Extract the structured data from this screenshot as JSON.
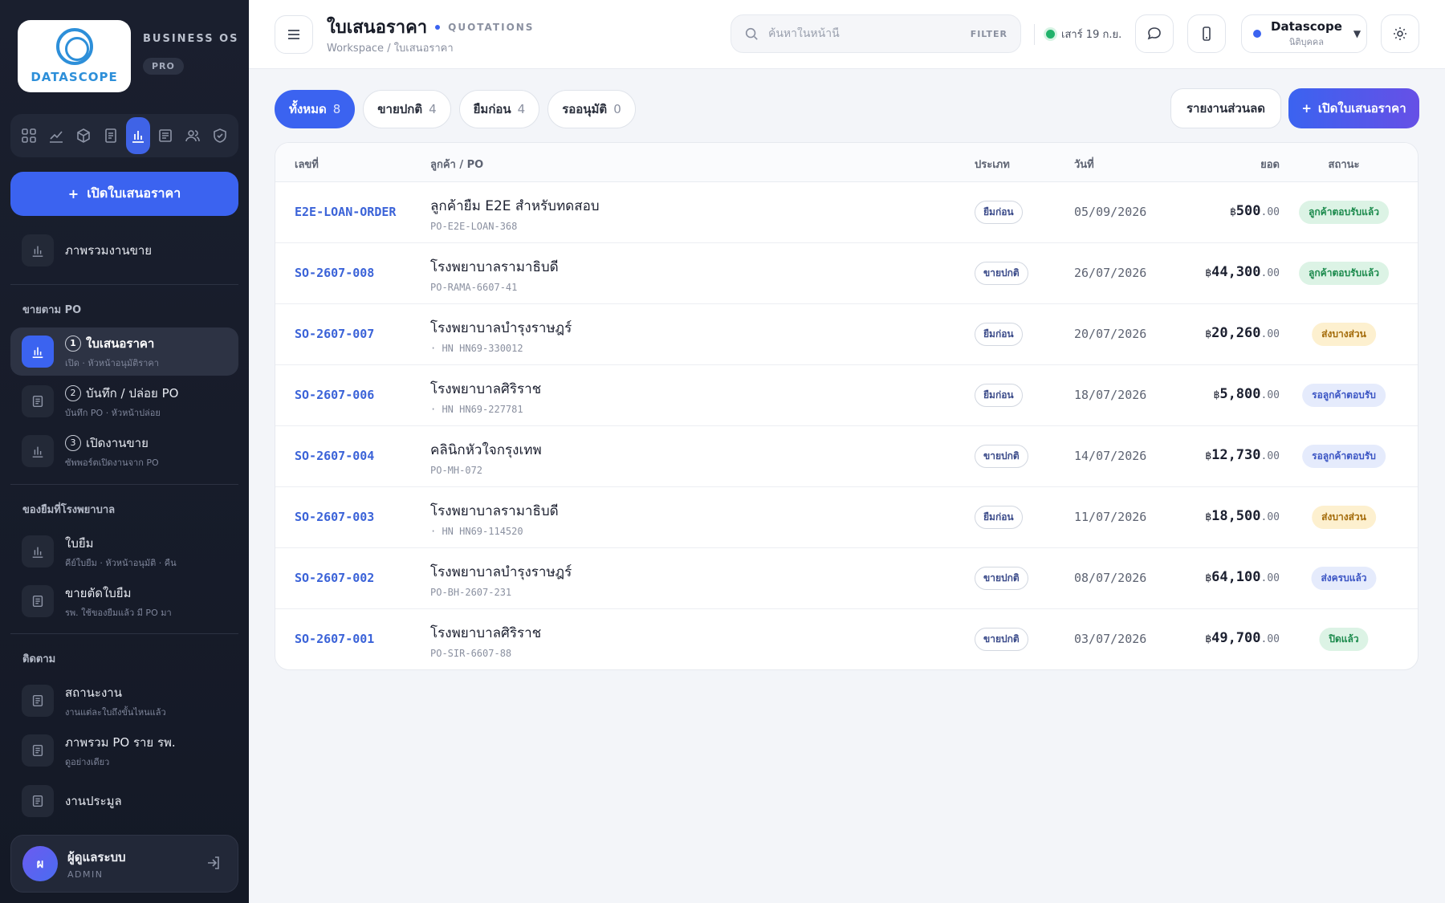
{
  "brand": {
    "logo_text": "DATASCOPE",
    "title": "BUSINESS OS",
    "badge": "PRO"
  },
  "sidebar": {
    "cta_label": "เปิดใบเสนอราคา",
    "overview_label": "ภาพรวมงานขาย",
    "section_po": "ขายตาม PO",
    "po_items": [
      {
        "num": "1",
        "label": "ใบเสนอราคา",
        "sub": "เปิด · หัวหน้าอนุมัติราคา"
      },
      {
        "num": "2",
        "label": "บันทึก / ปล่อย PO",
        "sub": "บันทึก PO · หัวหน้าปล่อย"
      },
      {
        "num": "3",
        "label": "เปิดงานขาย",
        "sub": "ซัพพอร์ตเปิดงานจาก PO"
      }
    ],
    "section_loan": "ของยืมที่โรงพยาบาล",
    "loan_items": [
      {
        "label": "ใบยืม",
        "sub": "คีย์ใบยืม · หัวหน้าอนุมัติ · คืน"
      },
      {
        "label": "ขายตัดใบยืม",
        "sub": "รพ. ใช้ของยืมแล้ว มี PO มา"
      }
    ],
    "section_track": "ติดตาม",
    "track_items": [
      {
        "label": "สถานะงาน",
        "sub": "งานแต่ละใบถึงขั้นไหนแล้ว"
      },
      {
        "label": "ภาพรวม PO ราย รพ.",
        "sub": "ดูอย่างเดียว"
      },
      {
        "label": "งานประมูล",
        "sub": ""
      }
    ],
    "user": {
      "initial": "ผ",
      "name": "ผู้ดูแลระบบ",
      "role": "ADMIN"
    }
  },
  "header": {
    "title": "ใบเสนอราคา",
    "title_en": "QUOTATIONS",
    "breadcrumb": "Workspace / ใบเสนอราคา",
    "search_placeholder": "ค้นหาในหน้านี้",
    "search_tag": "FILTER",
    "status_text": "เสาร์ 19 ก.ย.",
    "org_name": "Datascope",
    "org_sub": "นิติบุคคล"
  },
  "tabs": [
    {
      "label": "ทั้งหมด",
      "count": "8"
    },
    {
      "label": "ขายปกติ",
      "count": "4"
    },
    {
      "label": "ยืมก่อน",
      "count": "4"
    },
    {
      "label": "รออนุมัติ",
      "count": "0"
    }
  ],
  "actions": {
    "report_label": "รายงานส่วนลด",
    "new_label": "เปิดใบเสนอราคา"
  },
  "table": {
    "columns": {
      "no": "เลขที่",
      "customer": "ลูกค้า / PO",
      "type": "ประเภท",
      "date": "วันที่",
      "amount": "ยอด",
      "status": "สถานะ"
    },
    "rows": [
      {
        "no": "E2E-LOAN-ORDER",
        "customer": "ลูกค้ายืม E2E สำหรับทดสอบ",
        "po": "PO-E2E-LOAN-368",
        "type": "ยืมก่อน",
        "date": "05/09/2026",
        "currency": "฿",
        "amount": "500",
        "decimals": ".00",
        "status": "ลูกค้าตอบรับแล้ว",
        "status_tone": "green"
      },
      {
        "no": "SO-2607-008",
        "customer": "โรงพยาบาลรามาธิบดี",
        "po": "PO-RAMA-6607-41",
        "type": "ขายปกติ",
        "date": "26/07/2026",
        "currency": "฿",
        "amount": "44,300",
        "decimals": ".00",
        "status": "ลูกค้าตอบรับแล้ว",
        "status_tone": "green"
      },
      {
        "no": "SO-2607-007",
        "customer": "โรงพยาบาลบำรุงราษฎร์",
        "po": "· HN HN69-330012",
        "type": "ยืมก่อน",
        "date": "20/07/2026",
        "currency": "฿",
        "amount": "20,260",
        "decimals": ".00",
        "status": "ส่งบางส่วน",
        "status_tone": "amber"
      },
      {
        "no": "SO-2607-006",
        "customer": "โรงพยาบาลศิริราช",
        "po": "· HN HN69-227781",
        "type": "ยืมก่อน",
        "date": "18/07/2026",
        "currency": "฿",
        "amount": "5,800",
        "decimals": ".00",
        "status": "รอลูกค้าตอบรับ",
        "status_tone": "blue"
      },
      {
        "no": "SO-2607-004",
        "customer": "คลินิกหัวใจกรุงเทพ",
        "po": "PO-MH-072",
        "type": "ขายปกติ",
        "date": "14/07/2026",
        "currency": "฿",
        "amount": "12,730",
        "decimals": ".00",
        "status": "รอลูกค้าตอบรับ",
        "status_tone": "blue"
      },
      {
        "no": "SO-2607-003",
        "customer": "โรงพยาบาลรามาธิบดี",
        "po": "· HN HN69-114520",
        "type": "ยืมก่อน",
        "date": "11/07/2026",
        "currency": "฿",
        "amount": "18,500",
        "decimals": ".00",
        "status": "ส่งบางส่วน",
        "status_tone": "amber"
      },
      {
        "no": "SO-2607-002",
        "customer": "โรงพยาบาลบำรุงราษฎร์",
        "po": "PO-BH-2607-231",
        "type": "ขายปกติ",
        "date": "08/07/2026",
        "currency": "฿",
        "amount": "64,100",
        "decimals": ".00",
        "status": "ส่งครบแล้ว",
        "status_tone": "blue"
      },
      {
        "no": "SO-2607-001",
        "customer": "โรงพยาบาลศิริราช",
        "po": "PO-SIR-6607-88",
        "type": "ขายปกติ",
        "date": "03/07/2026",
        "currency": "฿",
        "amount": "49,700",
        "decimals": ".00",
        "status": "ปิดแล้ว",
        "status_tone": "green"
      }
    ]
  }
}
